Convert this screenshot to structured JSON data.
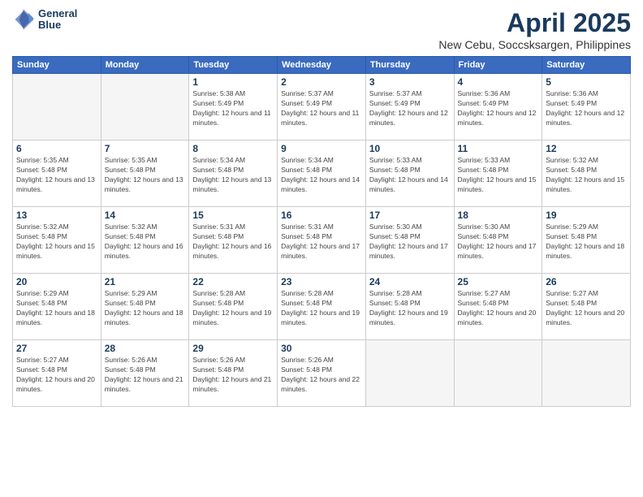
{
  "logo": {
    "line1": "General",
    "line2": "Blue"
  },
  "title": "April 2025",
  "subtitle": "New Cebu, Soccsksargen, Philippines",
  "header": {
    "days": [
      "Sunday",
      "Monday",
      "Tuesday",
      "Wednesday",
      "Thursday",
      "Friday",
      "Saturday"
    ]
  },
  "weeks": [
    [
      {
        "day": "",
        "sunrise": "",
        "sunset": "",
        "daylight": ""
      },
      {
        "day": "",
        "sunrise": "",
        "sunset": "",
        "daylight": ""
      },
      {
        "day": "1",
        "sunrise": "Sunrise: 5:38 AM",
        "sunset": "Sunset: 5:49 PM",
        "daylight": "Daylight: 12 hours and 11 minutes."
      },
      {
        "day": "2",
        "sunrise": "Sunrise: 5:37 AM",
        "sunset": "Sunset: 5:49 PM",
        "daylight": "Daylight: 12 hours and 11 minutes."
      },
      {
        "day": "3",
        "sunrise": "Sunrise: 5:37 AM",
        "sunset": "Sunset: 5:49 PM",
        "daylight": "Daylight: 12 hours and 12 minutes."
      },
      {
        "day": "4",
        "sunrise": "Sunrise: 5:36 AM",
        "sunset": "Sunset: 5:49 PM",
        "daylight": "Daylight: 12 hours and 12 minutes."
      },
      {
        "day": "5",
        "sunrise": "Sunrise: 5:36 AM",
        "sunset": "Sunset: 5:49 PM",
        "daylight": "Daylight: 12 hours and 12 minutes."
      }
    ],
    [
      {
        "day": "6",
        "sunrise": "Sunrise: 5:35 AM",
        "sunset": "Sunset: 5:48 PM",
        "daylight": "Daylight: 12 hours and 13 minutes."
      },
      {
        "day": "7",
        "sunrise": "Sunrise: 5:35 AM",
        "sunset": "Sunset: 5:48 PM",
        "daylight": "Daylight: 12 hours and 13 minutes."
      },
      {
        "day": "8",
        "sunrise": "Sunrise: 5:34 AM",
        "sunset": "Sunset: 5:48 PM",
        "daylight": "Daylight: 12 hours and 13 minutes."
      },
      {
        "day": "9",
        "sunrise": "Sunrise: 5:34 AM",
        "sunset": "Sunset: 5:48 PM",
        "daylight": "Daylight: 12 hours and 14 minutes."
      },
      {
        "day": "10",
        "sunrise": "Sunrise: 5:33 AM",
        "sunset": "Sunset: 5:48 PM",
        "daylight": "Daylight: 12 hours and 14 minutes."
      },
      {
        "day": "11",
        "sunrise": "Sunrise: 5:33 AM",
        "sunset": "Sunset: 5:48 PM",
        "daylight": "Daylight: 12 hours and 15 minutes."
      },
      {
        "day": "12",
        "sunrise": "Sunrise: 5:32 AM",
        "sunset": "Sunset: 5:48 PM",
        "daylight": "Daylight: 12 hours and 15 minutes."
      }
    ],
    [
      {
        "day": "13",
        "sunrise": "Sunrise: 5:32 AM",
        "sunset": "Sunset: 5:48 PM",
        "daylight": "Daylight: 12 hours and 15 minutes."
      },
      {
        "day": "14",
        "sunrise": "Sunrise: 5:32 AM",
        "sunset": "Sunset: 5:48 PM",
        "daylight": "Daylight: 12 hours and 16 minutes."
      },
      {
        "day": "15",
        "sunrise": "Sunrise: 5:31 AM",
        "sunset": "Sunset: 5:48 PM",
        "daylight": "Daylight: 12 hours and 16 minutes."
      },
      {
        "day": "16",
        "sunrise": "Sunrise: 5:31 AM",
        "sunset": "Sunset: 5:48 PM",
        "daylight": "Daylight: 12 hours and 17 minutes."
      },
      {
        "day": "17",
        "sunrise": "Sunrise: 5:30 AM",
        "sunset": "Sunset: 5:48 PM",
        "daylight": "Daylight: 12 hours and 17 minutes."
      },
      {
        "day": "18",
        "sunrise": "Sunrise: 5:30 AM",
        "sunset": "Sunset: 5:48 PM",
        "daylight": "Daylight: 12 hours and 17 minutes."
      },
      {
        "day": "19",
        "sunrise": "Sunrise: 5:29 AM",
        "sunset": "Sunset: 5:48 PM",
        "daylight": "Daylight: 12 hours and 18 minutes."
      }
    ],
    [
      {
        "day": "20",
        "sunrise": "Sunrise: 5:29 AM",
        "sunset": "Sunset: 5:48 PM",
        "daylight": "Daylight: 12 hours and 18 minutes."
      },
      {
        "day": "21",
        "sunrise": "Sunrise: 5:29 AM",
        "sunset": "Sunset: 5:48 PM",
        "daylight": "Daylight: 12 hours and 18 minutes."
      },
      {
        "day": "22",
        "sunrise": "Sunrise: 5:28 AM",
        "sunset": "Sunset: 5:48 PM",
        "daylight": "Daylight: 12 hours and 19 minutes."
      },
      {
        "day": "23",
        "sunrise": "Sunrise: 5:28 AM",
        "sunset": "Sunset: 5:48 PM",
        "daylight": "Daylight: 12 hours and 19 minutes."
      },
      {
        "day": "24",
        "sunrise": "Sunrise: 5:28 AM",
        "sunset": "Sunset: 5:48 PM",
        "daylight": "Daylight: 12 hours and 19 minutes."
      },
      {
        "day": "25",
        "sunrise": "Sunrise: 5:27 AM",
        "sunset": "Sunset: 5:48 PM",
        "daylight": "Daylight: 12 hours and 20 minutes."
      },
      {
        "day": "26",
        "sunrise": "Sunrise: 5:27 AM",
        "sunset": "Sunset: 5:48 PM",
        "daylight": "Daylight: 12 hours and 20 minutes."
      }
    ],
    [
      {
        "day": "27",
        "sunrise": "Sunrise: 5:27 AM",
        "sunset": "Sunset: 5:48 PM",
        "daylight": "Daylight: 12 hours and 20 minutes."
      },
      {
        "day": "28",
        "sunrise": "Sunrise: 5:26 AM",
        "sunset": "Sunset: 5:48 PM",
        "daylight": "Daylight: 12 hours and 21 minutes."
      },
      {
        "day": "29",
        "sunrise": "Sunrise: 5:26 AM",
        "sunset": "Sunset: 5:48 PM",
        "daylight": "Daylight: 12 hours and 21 minutes."
      },
      {
        "day": "30",
        "sunrise": "Sunrise: 5:26 AM",
        "sunset": "Sunset: 5:48 PM",
        "daylight": "Daylight: 12 hours and 22 minutes."
      },
      {
        "day": "",
        "sunrise": "",
        "sunset": "",
        "daylight": ""
      },
      {
        "day": "",
        "sunrise": "",
        "sunset": "",
        "daylight": ""
      },
      {
        "day": "",
        "sunrise": "",
        "sunset": "",
        "daylight": ""
      }
    ]
  ]
}
